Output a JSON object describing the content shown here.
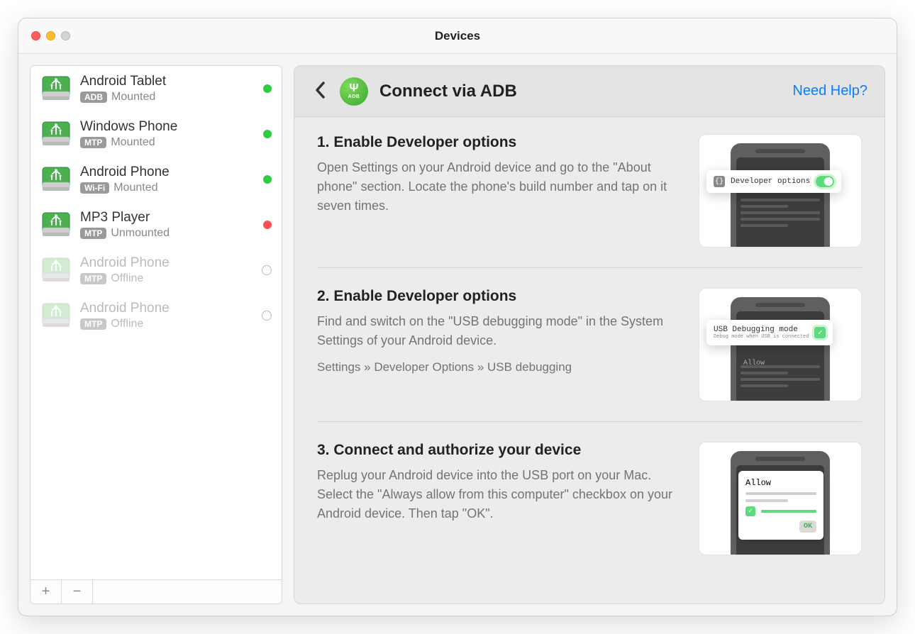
{
  "window": {
    "title": "Devices"
  },
  "sidebar": {
    "devices": [
      {
        "name": "Android Tablet",
        "badge": "ADB",
        "status": "Mounted",
        "dot": "green",
        "dim": false
      },
      {
        "name": "Windows Phone",
        "badge": "MTP",
        "status": "Mounted",
        "dot": "green",
        "dim": false
      },
      {
        "name": "Android Phone",
        "badge": "Wi-Fi",
        "status": "Mounted",
        "dot": "green",
        "dim": false
      },
      {
        "name": "MP3 Player",
        "badge": "MTP",
        "status": "Unmounted",
        "dot": "red",
        "dim": false
      },
      {
        "name": "Android Phone",
        "badge": "MTP",
        "status": "Offline",
        "dot": "ring",
        "dim": true
      },
      {
        "name": "Android Phone",
        "badge": "MTP",
        "status": "Offline",
        "dot": "ring",
        "dim": true
      }
    ],
    "add_label": "+",
    "remove_label": "−"
  },
  "main": {
    "title": "Connect via ADB",
    "help": "Need Help?",
    "steps": [
      {
        "title": "1. Enable Developer options",
        "desc": "Open Settings on your Android device and go to the \"About phone\" section. Locate the phone's build number and tap on it seven times.",
        "card_label": "Developer options"
      },
      {
        "title": "2. Enable Developer options",
        "desc": "Find and switch on the \"USB debugging mode\" in the System Settings of your Android device.",
        "path": "Settings » Developer Options » USB debugging",
        "card_label": "USB Debugging mode",
        "card_sub": "Debug mode when USB is connected",
        "allow_label": "Allow"
      },
      {
        "title": "3. Connect and authorize your device",
        "desc": "Replug your Android device into the USB port on your Mac. Select the \"Always allow from this computer\" checkbox on your Android device. Then tap \"OK\".",
        "allow_label": "Allow",
        "ok_label": "OK"
      }
    ]
  },
  "colors": {
    "green": "#2ecc40",
    "red": "#ff4f4f",
    "link": "#0a7cff",
    "adb_green": "#3ba935"
  }
}
